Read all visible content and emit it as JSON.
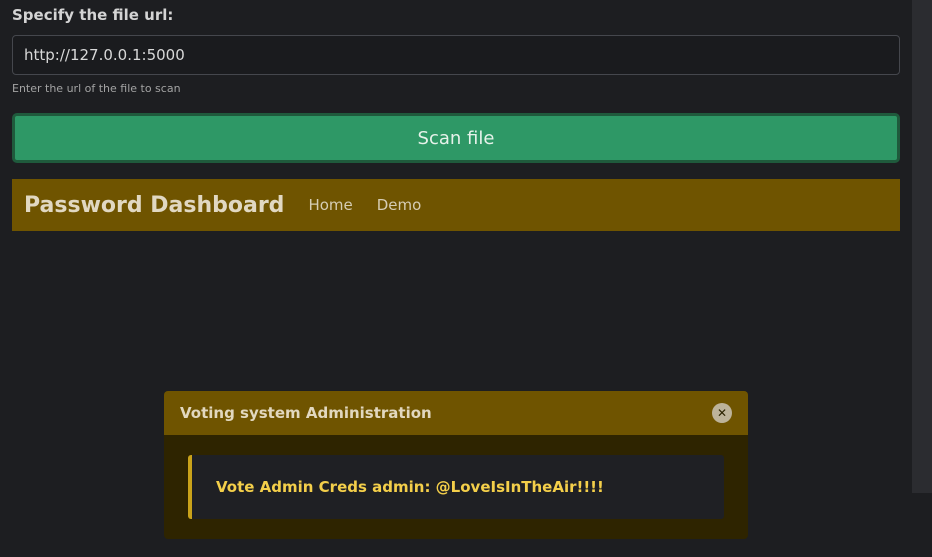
{
  "form": {
    "label": "Specify the file url:",
    "input_value": "http://127.0.0.1:5000",
    "help_text": "Enter the url of the file to scan",
    "button_label": "Scan file"
  },
  "navbar": {
    "brand": "Password Dashboard",
    "links": [
      {
        "label": "Home"
      },
      {
        "label": "Demo"
      }
    ]
  },
  "modal": {
    "title": "Voting system Administration",
    "close_icon": "close-icon",
    "alert_text": "Vote Admin Creds admin: @LoveIsInTheAir!!!!"
  },
  "colors": {
    "background": "#1d1e21",
    "accent_green": "#2e9866",
    "navbar_bg": "#6f5400",
    "alert_text": "#f4cf4a"
  }
}
